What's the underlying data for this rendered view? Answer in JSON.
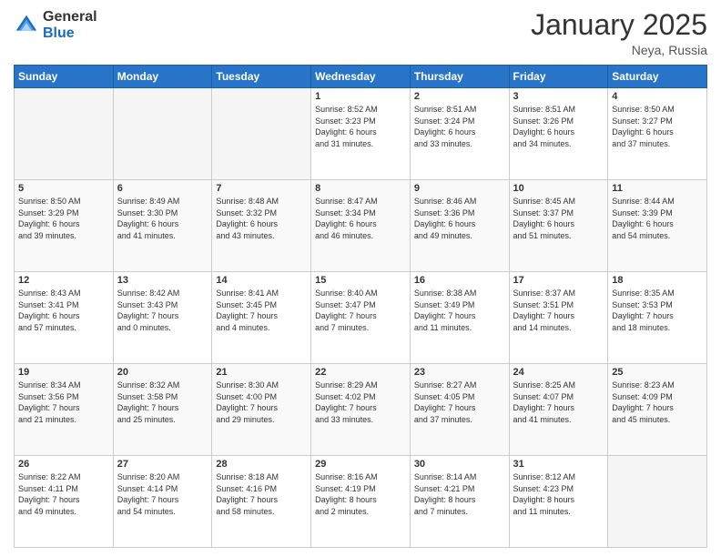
{
  "header": {
    "logo_general": "General",
    "logo_blue": "Blue",
    "month_title": "January 2025",
    "location": "Neya, Russia"
  },
  "days_of_week": [
    "Sunday",
    "Monday",
    "Tuesday",
    "Wednesday",
    "Thursday",
    "Friday",
    "Saturday"
  ],
  "weeks": [
    [
      {
        "day": "",
        "info": ""
      },
      {
        "day": "",
        "info": ""
      },
      {
        "day": "",
        "info": ""
      },
      {
        "day": "1",
        "info": "Sunrise: 8:52 AM\nSunset: 3:23 PM\nDaylight: 6 hours\nand 31 minutes."
      },
      {
        "day": "2",
        "info": "Sunrise: 8:51 AM\nSunset: 3:24 PM\nDaylight: 6 hours\nand 33 minutes."
      },
      {
        "day": "3",
        "info": "Sunrise: 8:51 AM\nSunset: 3:26 PM\nDaylight: 6 hours\nand 34 minutes."
      },
      {
        "day": "4",
        "info": "Sunrise: 8:50 AM\nSunset: 3:27 PM\nDaylight: 6 hours\nand 37 minutes."
      }
    ],
    [
      {
        "day": "5",
        "info": "Sunrise: 8:50 AM\nSunset: 3:29 PM\nDaylight: 6 hours\nand 39 minutes."
      },
      {
        "day": "6",
        "info": "Sunrise: 8:49 AM\nSunset: 3:30 PM\nDaylight: 6 hours\nand 41 minutes."
      },
      {
        "day": "7",
        "info": "Sunrise: 8:48 AM\nSunset: 3:32 PM\nDaylight: 6 hours\nand 43 minutes."
      },
      {
        "day": "8",
        "info": "Sunrise: 8:47 AM\nSunset: 3:34 PM\nDaylight: 6 hours\nand 46 minutes."
      },
      {
        "day": "9",
        "info": "Sunrise: 8:46 AM\nSunset: 3:36 PM\nDaylight: 6 hours\nand 49 minutes."
      },
      {
        "day": "10",
        "info": "Sunrise: 8:45 AM\nSunset: 3:37 PM\nDaylight: 6 hours\nand 51 minutes."
      },
      {
        "day": "11",
        "info": "Sunrise: 8:44 AM\nSunset: 3:39 PM\nDaylight: 6 hours\nand 54 minutes."
      }
    ],
    [
      {
        "day": "12",
        "info": "Sunrise: 8:43 AM\nSunset: 3:41 PM\nDaylight: 6 hours\nand 57 minutes."
      },
      {
        "day": "13",
        "info": "Sunrise: 8:42 AM\nSunset: 3:43 PM\nDaylight: 7 hours\nand 0 minutes."
      },
      {
        "day": "14",
        "info": "Sunrise: 8:41 AM\nSunset: 3:45 PM\nDaylight: 7 hours\nand 4 minutes."
      },
      {
        "day": "15",
        "info": "Sunrise: 8:40 AM\nSunset: 3:47 PM\nDaylight: 7 hours\nand 7 minutes."
      },
      {
        "day": "16",
        "info": "Sunrise: 8:38 AM\nSunset: 3:49 PM\nDaylight: 7 hours\nand 11 minutes."
      },
      {
        "day": "17",
        "info": "Sunrise: 8:37 AM\nSunset: 3:51 PM\nDaylight: 7 hours\nand 14 minutes."
      },
      {
        "day": "18",
        "info": "Sunrise: 8:35 AM\nSunset: 3:53 PM\nDaylight: 7 hours\nand 18 minutes."
      }
    ],
    [
      {
        "day": "19",
        "info": "Sunrise: 8:34 AM\nSunset: 3:56 PM\nDaylight: 7 hours\nand 21 minutes."
      },
      {
        "day": "20",
        "info": "Sunrise: 8:32 AM\nSunset: 3:58 PM\nDaylight: 7 hours\nand 25 minutes."
      },
      {
        "day": "21",
        "info": "Sunrise: 8:30 AM\nSunset: 4:00 PM\nDaylight: 7 hours\nand 29 minutes."
      },
      {
        "day": "22",
        "info": "Sunrise: 8:29 AM\nSunset: 4:02 PM\nDaylight: 7 hours\nand 33 minutes."
      },
      {
        "day": "23",
        "info": "Sunrise: 8:27 AM\nSunset: 4:05 PM\nDaylight: 7 hours\nand 37 minutes."
      },
      {
        "day": "24",
        "info": "Sunrise: 8:25 AM\nSunset: 4:07 PM\nDaylight: 7 hours\nand 41 minutes."
      },
      {
        "day": "25",
        "info": "Sunrise: 8:23 AM\nSunset: 4:09 PM\nDaylight: 7 hours\nand 45 minutes."
      }
    ],
    [
      {
        "day": "26",
        "info": "Sunrise: 8:22 AM\nSunset: 4:11 PM\nDaylight: 7 hours\nand 49 minutes."
      },
      {
        "day": "27",
        "info": "Sunrise: 8:20 AM\nSunset: 4:14 PM\nDaylight: 7 hours\nand 54 minutes."
      },
      {
        "day": "28",
        "info": "Sunrise: 8:18 AM\nSunset: 4:16 PM\nDaylight: 7 hours\nand 58 minutes."
      },
      {
        "day": "29",
        "info": "Sunrise: 8:16 AM\nSunset: 4:19 PM\nDaylight: 8 hours\nand 2 minutes."
      },
      {
        "day": "30",
        "info": "Sunrise: 8:14 AM\nSunset: 4:21 PM\nDaylight: 8 hours\nand 7 minutes."
      },
      {
        "day": "31",
        "info": "Sunrise: 8:12 AM\nSunset: 4:23 PM\nDaylight: 8 hours\nand 11 minutes."
      },
      {
        "day": "",
        "info": ""
      }
    ]
  ]
}
